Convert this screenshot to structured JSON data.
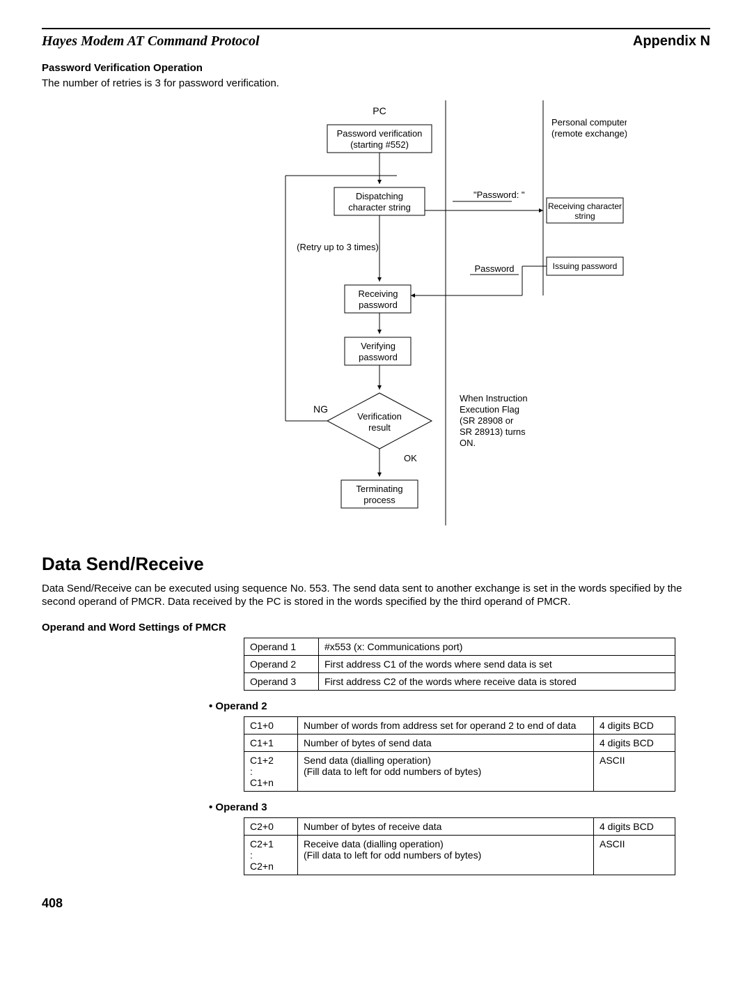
{
  "header": {
    "left": "Hayes Modem AT Command Protocol",
    "right": "Appendix N"
  },
  "pwdSection": {
    "title": "Password Verification Operation",
    "body": "The number of retries is 3 for password verification."
  },
  "diagram": {
    "col_pc": "PC",
    "box_start1": "Password verification",
    "box_start2": "(starting #552)",
    "box_dispatch1": "Dispatching",
    "box_dispatch2": "character string",
    "retry": "(Retry up to 3 times)",
    "box_recv1": "Receiving",
    "box_recv2": "password",
    "box_verify1": "Verifying",
    "box_verify2": "password",
    "ng": "NG",
    "verif1": "Verification",
    "verif2": "result",
    "ok": "OK",
    "term1": "Terminating",
    "term2": "process",
    "col_pc_remote1": "Personal computer",
    "col_pc_remote2": "(remote exchange)",
    "pwd_prompt": "\"Password: \"",
    "box_recvchar1": "Receiving character",
    "box_recvchar2": "string",
    "pwd_word": "Password",
    "box_issue": "Issuing password",
    "note1": "When Instruction",
    "note2": "Execution Flag",
    "note3": "(SR 28908 or",
    "note4": "SR 28913) turns",
    "note5": "ON."
  },
  "dsr": {
    "title": "Data Send/Receive",
    "body": "Data Send/Receive can be executed using sequence No. 553. The send data sent to another exchange is set in the words specified by the second operand of PMCR. Data received by the PC is stored in the words specified by the third operand of PMCR.",
    "opTitle": "Operand and Word Settings of PMCR",
    "opTable": [
      {
        "c1": "Operand 1",
        "c2": "#x553 (x: Communications port)"
      },
      {
        "c1": "Operand 2",
        "c2": "First address C1 of the words where send data is set"
      },
      {
        "c1": "Operand 3",
        "c2": "First address C2 of the words where receive data is stored"
      }
    ],
    "op2Title": "• Operand 2",
    "op2Table": [
      {
        "c1": "C1+0",
        "c2": "Number of words from address set for operand 2 to end of data",
        "c3": "4 digits BCD"
      },
      {
        "c1": "C1+1",
        "c2": "Number of bytes of send data",
        "c3": "4 digits BCD"
      },
      {
        "c1": "C1+2\n :\nC1+n",
        "c2": "Send data (dialling operation)\n(Fill data to left for odd numbers of bytes)",
        "c3": "ASCII"
      }
    ],
    "op3Title": "• Operand 3",
    "op3Table": [
      {
        "c1": "C2+0",
        "c2": "Number of bytes of receive data",
        "c3": "4 digits BCD"
      },
      {
        "c1": "C2+1\n :\nC2+n",
        "c2": "Receive data (dialling operation)\n(Fill data to left for odd numbers of bytes)",
        "c3": "ASCII"
      }
    ]
  },
  "pageNumber": "408"
}
